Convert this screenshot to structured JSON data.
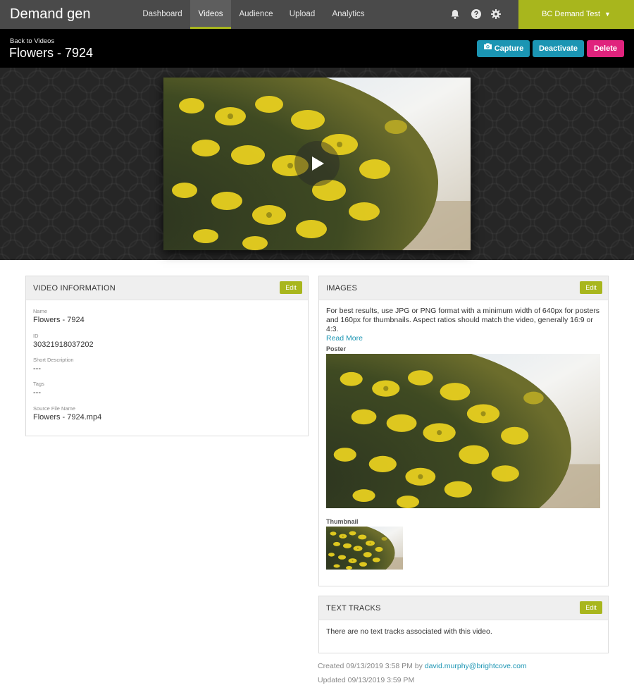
{
  "app": {
    "brand": "Demand gen"
  },
  "nav": {
    "tabs": [
      {
        "label": "Dashboard"
      },
      {
        "label": "Videos"
      },
      {
        "label": "Audience"
      },
      {
        "label": "Upload"
      },
      {
        "label": "Analytics"
      }
    ],
    "active_tab": "Videos",
    "icons": [
      "bell-icon",
      "help-icon",
      "gear-icon"
    ],
    "account_label": "BC Demand Test",
    "account_caret": "▼"
  },
  "header": {
    "back_link": "Back to Videos",
    "title": "Flowers - 7924",
    "buttons": {
      "capture": "Capture",
      "deactivate": "Deactivate",
      "delete": "Delete"
    }
  },
  "video_info": {
    "title": "VIDEO INFORMATION",
    "edit_label": "Edit",
    "fields": [
      {
        "label": "Name",
        "value": "Flowers - 7924"
      },
      {
        "label": "ID",
        "value": "30321918037202"
      },
      {
        "label": "Short Description",
        "value": "---"
      },
      {
        "label": "Tags",
        "value": "---"
      },
      {
        "label": "Source File Name",
        "value": "Flowers - 7924.mp4"
      }
    ]
  },
  "images": {
    "title": "IMAGES",
    "edit_label": "Edit",
    "note": "For best results, use JPG or PNG format with a minimum width of 640px for posters and 160px for thumbnails. Aspect ratios should match the video, generally 16:9 or 4:3.",
    "read_more": "Read More",
    "poster_label": "Poster",
    "thumbnail_label": "Thumbnail"
  },
  "text_tracks": {
    "title": "TEXT TRACKS",
    "edit_label": "Edit",
    "empty_message": "There are no text tracks associated with this video."
  },
  "meta": {
    "created_prefix": "Created 09/13/2019 3:58 PM by",
    "created_by": "david.murphy@brightcove.com",
    "updated": "Updated 09/13/2019 3:59 PM"
  },
  "colors": {
    "accent": "#a8b61d",
    "primary_button": "#1b95b3",
    "danger_button": "#e0237d",
    "nav_bg": "#4a4a4a"
  }
}
